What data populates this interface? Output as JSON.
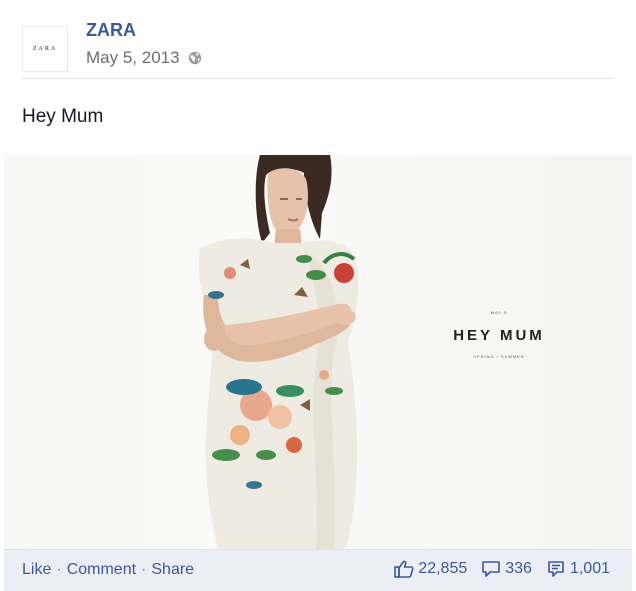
{
  "post": {
    "page_name": "ZARA",
    "avatar_text": "ZARA",
    "date": "May 5, 2013",
    "privacy_icon": "globe-icon",
    "message": "Hey Mum",
    "photo": {
      "ad_small_top": "MAY 5",
      "ad_headline": "HEY MUM",
      "ad_small_bottom": "SPRING / SUMMER"
    }
  },
  "footer": {
    "like_label": "Like",
    "comment_label": "Comment",
    "share_label": "Share",
    "separator": "·",
    "likes_count": "22,855",
    "comments_count": "336",
    "shares_count": "1,001"
  },
  "colors": {
    "link": "#3b5998",
    "footer_bg": "#eceef5",
    "meta_text": "#6e6e6e"
  }
}
